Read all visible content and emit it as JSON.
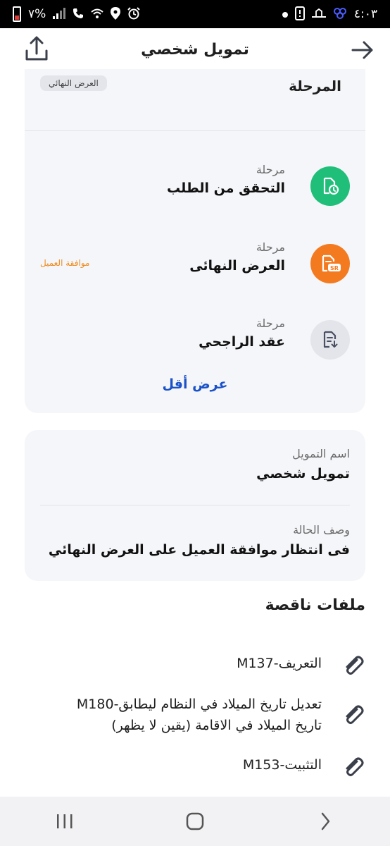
{
  "status_bar": {
    "time": "٤:٠٣",
    "battery_percent": "٧%",
    "left_icons": [
      "battery-icon",
      "signal-icon",
      "call-icon",
      "wifi-icon",
      "location-icon",
      "alarm-icon"
    ],
    "right_icons": [
      "dot-icon",
      "alert-icon",
      "app-icon",
      "app-icon-2"
    ]
  },
  "header": {
    "title": "تمويل شخصي",
    "back_icon": "arrow-right-icon",
    "share_icon": "share-icon"
  },
  "stages": {
    "header_label": "المرحلة",
    "current_chip": "العرض النهائي",
    "items": [
      {
        "sub": "مرحلة",
        "name": "التحقق من الطلب",
        "status": "",
        "icon": "verify-icon",
        "color": "#1fbf7a"
      },
      {
        "sub": "مرحلة",
        "name": "العرض النهائى",
        "status": "موافقة العميل",
        "icon": "offer-icon",
        "color": "#f47a1f"
      },
      {
        "sub": "مرحلة",
        "name": "عقد الراجحي",
        "status": "",
        "icon": "contract-icon",
        "color": "#e3e5eb"
      }
    ],
    "show_less": "عرض أقل"
  },
  "info": {
    "finance_name_label": "اسم التمويل",
    "finance_name_value": "تمويل شخصي",
    "status_desc_label": "وصف الحالة",
    "status_desc_value": "فى انتظار موافقة العميل على العرض النهائي"
  },
  "missing_files": {
    "title": "ملفات ناقصة",
    "items": [
      {
        "line1": "التعريف-M137",
        "line2": ""
      },
      {
        "line1": "تعديل تاريخ الميلاد  في النظام ليطابق-M180",
        "line2": "تاريخ الميلاد في الاقامة (يقين لا يظهر)"
      },
      {
        "line1": "التثبيت-M153",
        "line2": ""
      }
    ]
  },
  "nav": {
    "recent_icon": "recent-apps-icon",
    "home_icon": "home-icon",
    "back_icon": "back-icon"
  }
}
